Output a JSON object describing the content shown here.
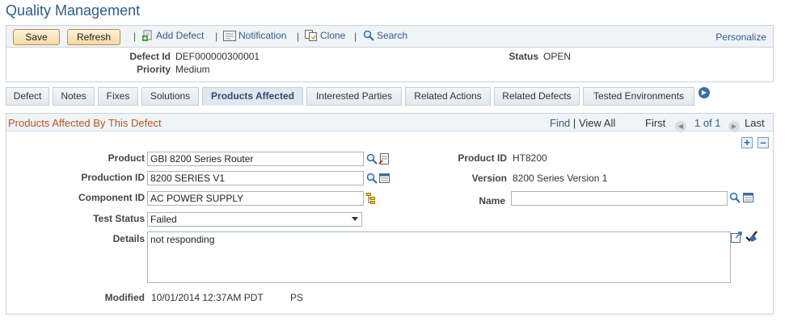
{
  "page": {
    "title": "Quality Management"
  },
  "toolbar": {
    "save_label": "Save",
    "refresh_label": "Refresh",
    "add_defect_label": "Add Defect",
    "notification_label": "Notification",
    "clone_label": "Clone",
    "search_label": "Search",
    "personalize_label": "Personalize",
    "separator": "|"
  },
  "header": {
    "defect_id_label": "Defect Id",
    "defect_id_value": "DEF000000300001",
    "priority_label": "Priority",
    "priority_value": "Medium",
    "status_label": "Status",
    "status_value": "OPEN"
  },
  "tabs": [
    {
      "label": "Defect"
    },
    {
      "label": "Notes"
    },
    {
      "label": "Fixes"
    },
    {
      "label": "Solutions"
    },
    {
      "label": "Products Affected"
    },
    {
      "label": "Interested Parties"
    },
    {
      "label": "Related Actions"
    },
    {
      "label": "Related Defects"
    },
    {
      "label": "Tested Environments"
    }
  ],
  "section": {
    "title": "Products Affected By This Defect",
    "find_label": "Find",
    "view_all_label": "View All",
    "first_label": "First",
    "counter": "1 of 1",
    "last_label": "Last",
    "pipe": "|"
  },
  "form": {
    "product_label": "Product",
    "product_value": "GBI 8200 Series Router",
    "production_id_label": "Production ID",
    "production_id_value": "8200 SERIES V1",
    "component_id_label": "Component ID",
    "component_id_value": "AC POWER SUPPLY",
    "test_status_label": "Test Status",
    "test_status_value": "Failed",
    "details_label": "Details",
    "details_value": "not responding",
    "product_id_label": "Product ID",
    "product_id_value": "HT8200",
    "version_label": "Version",
    "version_value": "8200 Series Version 1",
    "name_label": "Name",
    "name_value": "",
    "modified_label": "Modified",
    "modified_value": "10/01/2014 12:37AM PDT",
    "modified_by": "PS"
  },
  "colors": {
    "accent": "#2e5b8b",
    "section_title": "#b5571f",
    "button_bg": "#f8d9a2"
  }
}
